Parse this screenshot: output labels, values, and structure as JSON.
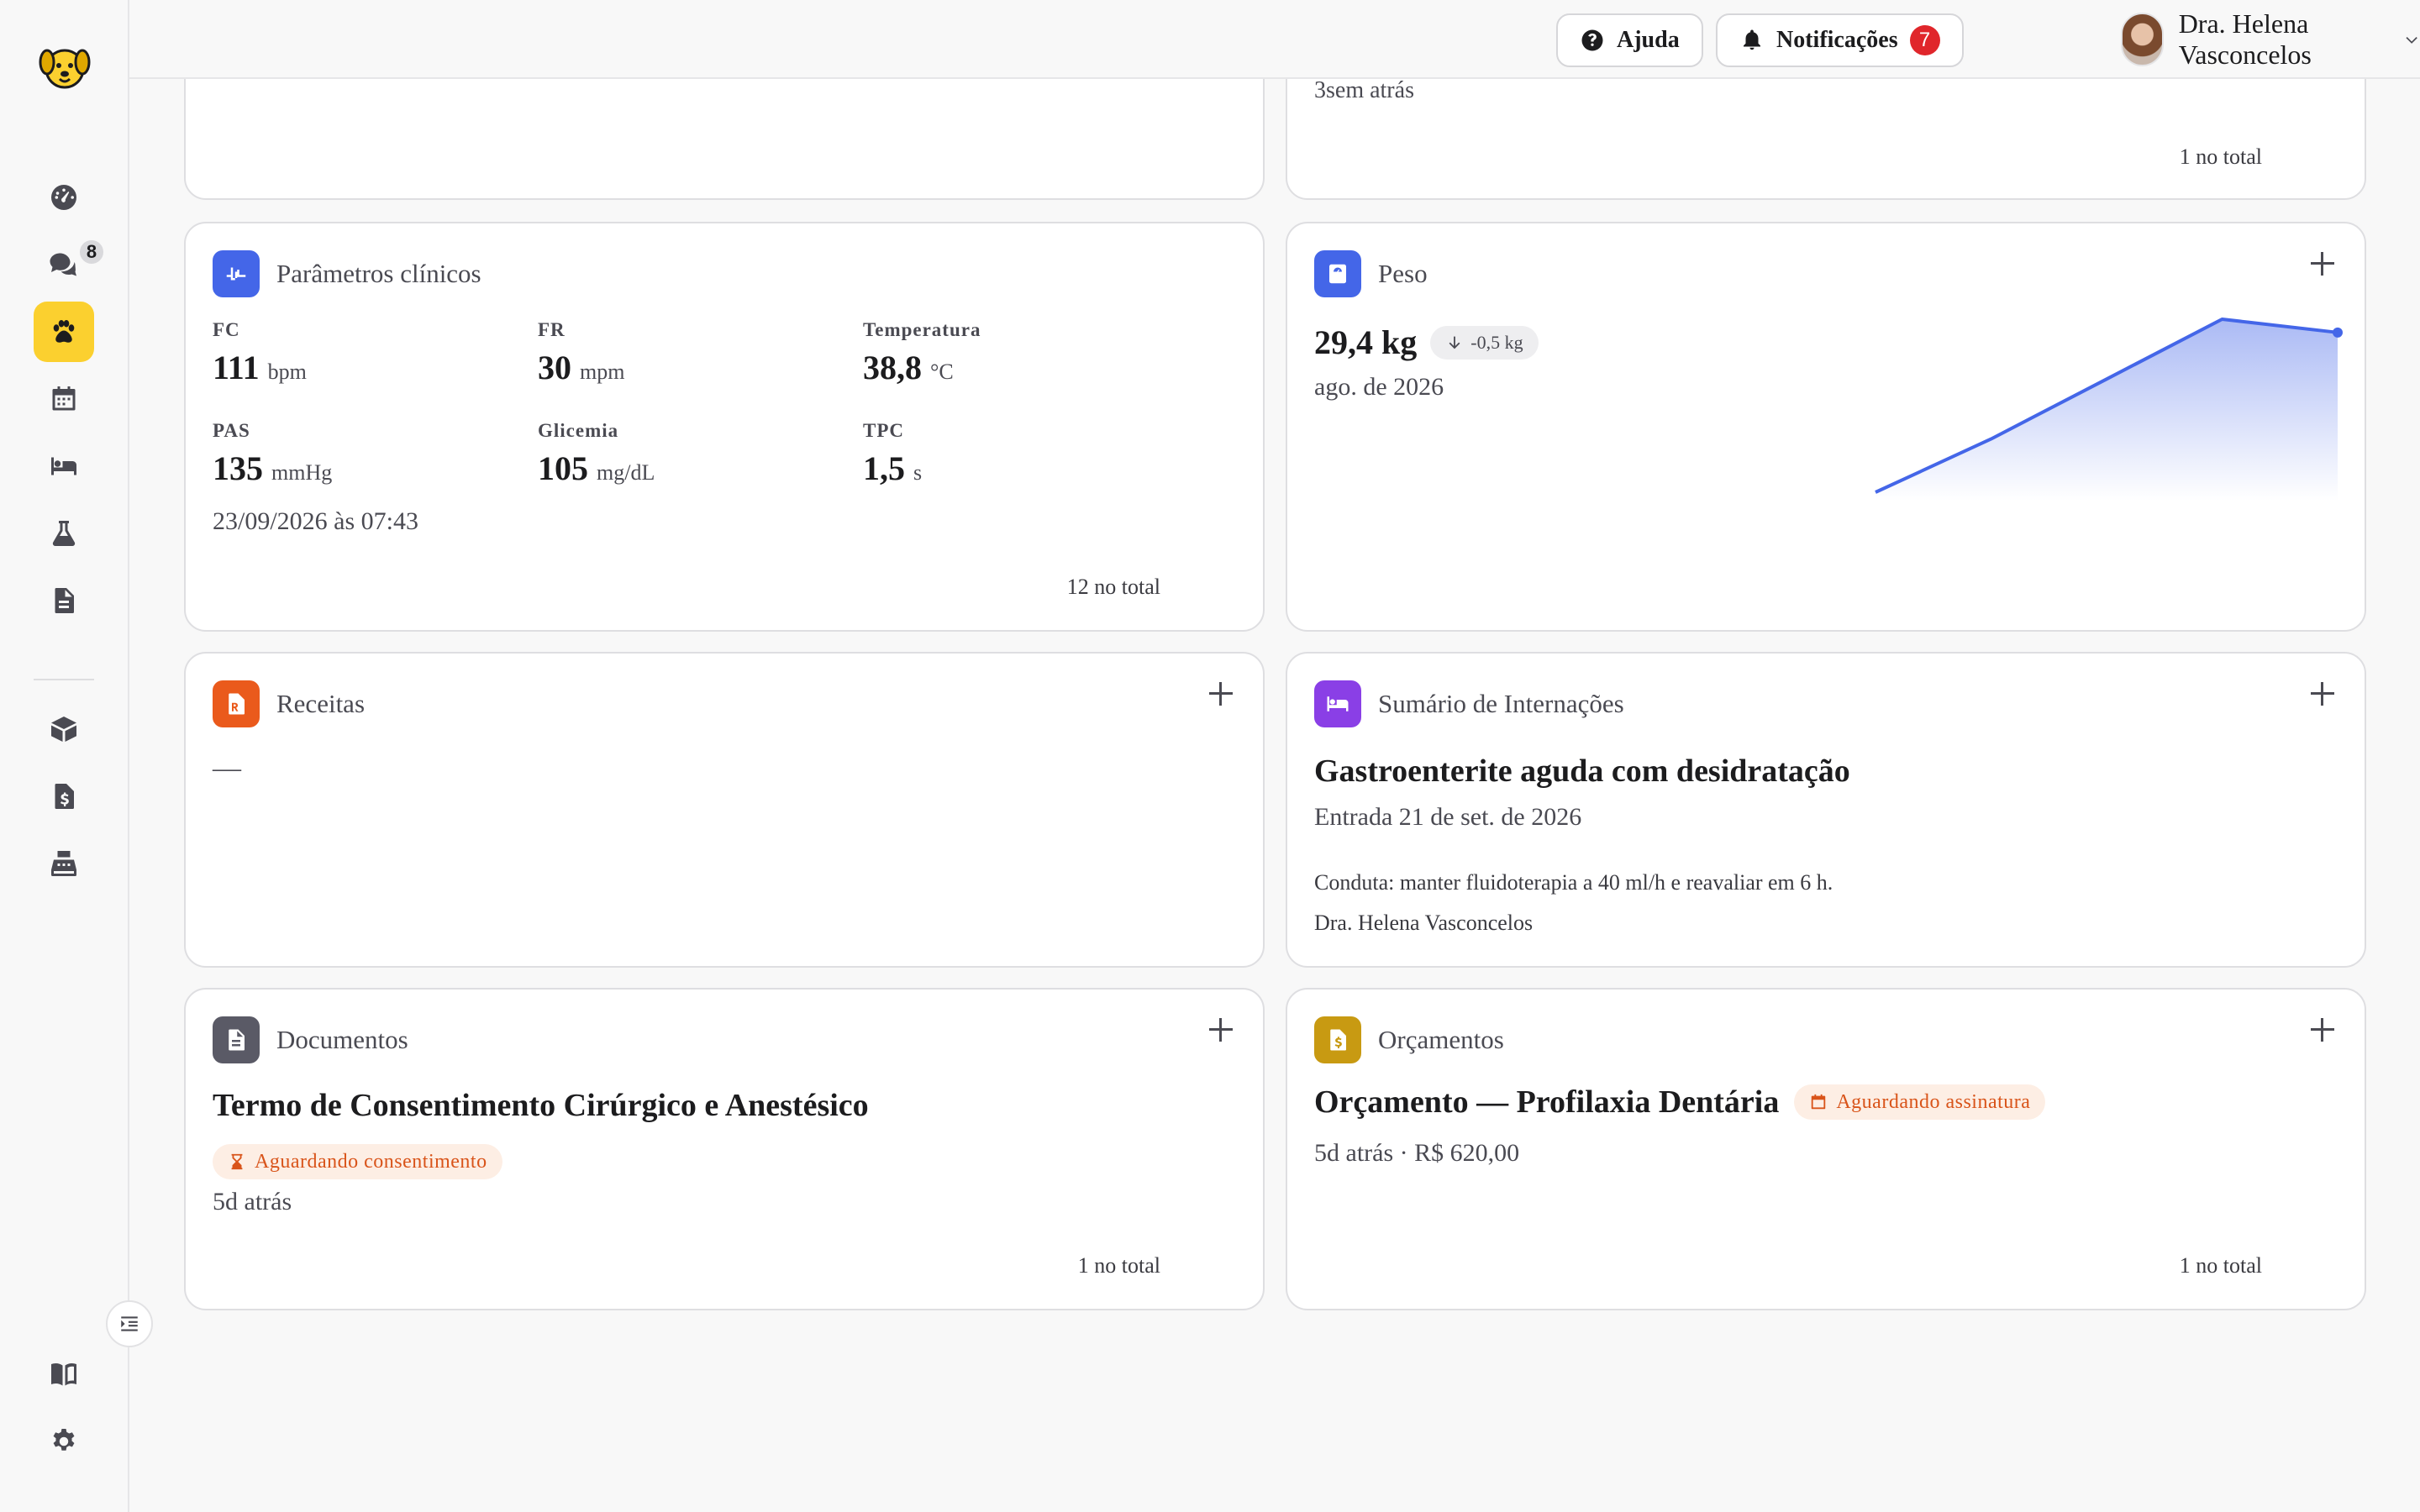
{
  "sidebar": {
    "message_badge": "8"
  },
  "header": {
    "help_label": "Ajuda",
    "notifications_label": "Notificações",
    "notifications_count": "7",
    "user_name": "Dra. Helena Vasconcelos"
  },
  "top_right_card": {
    "time_ago": "3sem atrás",
    "total": "1 no total"
  },
  "clinical": {
    "title": "Parâmetros clínicos",
    "params": [
      {
        "label": "FC",
        "value": "111",
        "unit": "bpm"
      },
      {
        "label": "FR",
        "value": "30",
        "unit": "mpm"
      },
      {
        "label": "Temperatura",
        "value": "38,8",
        "unit": "°C"
      },
      {
        "label": "PAS",
        "value": "135",
        "unit": "mmHg"
      },
      {
        "label": "Glicemia",
        "value": "105",
        "unit": "mg/dL"
      },
      {
        "label": "TPC",
        "value": "1,5",
        "unit": "s"
      }
    ],
    "timestamp": "23/09/2026 às 07:43",
    "total": "12 no total"
  },
  "weight": {
    "title": "Peso",
    "value": "29,4 kg",
    "delta": "-0,5 kg",
    "date": "ago. de 2026",
    "chart_data": {
      "type": "area",
      "values": [
        30.5,
        31.3,
        32.2,
        33.1,
        32.9
      ],
      "color": "#4466e8"
    }
  },
  "prescriptions": {
    "title": "Receitas",
    "empty": "—"
  },
  "hospitalization": {
    "title": "Sumário de Internações",
    "diagnosis": "Gastroenterite aguda com desidratação",
    "entry": "Entrada 21 de set. de 2026",
    "conduct": "Conduta: manter fluidoterapia a 40 ml/h e reavaliar em 6 h.",
    "doctor": "Dra. Helena Vasconcelos"
  },
  "documents": {
    "title": "Documentos",
    "doc_title": "Termo de Consentimento Cirúrgico e Anestésico",
    "status": "Aguardando consentimento",
    "time_ago": "5d atrás",
    "total": "1 no total"
  },
  "budgets": {
    "title": "Orçamentos",
    "budget_title": "Orçamento — Profilaxia Dentária",
    "status": "Aguardando assinatura",
    "meta": "5d atrás · R$ 620,00",
    "total": "1 no total"
  },
  "colors": {
    "accent": "#fbd02f",
    "clinical_icon": "#4466e8",
    "weight_icon": "#4466e8",
    "prescription_icon": "#ea5a1c",
    "hospital_icon": "#8a3fe6",
    "document_icon": "#5a5a66",
    "budget_icon": "#c89a12",
    "badge_red": "#e0262b",
    "pill_orange": "#d9541a"
  },
  "icons": [
    "dashboard-icon",
    "chat-icon",
    "paw-icon",
    "calendar-icon",
    "bed-icon",
    "flask-icon",
    "document-icon",
    "box-icon",
    "invoice-icon",
    "cash-register-icon",
    "book-icon",
    "gear-icon"
  ]
}
